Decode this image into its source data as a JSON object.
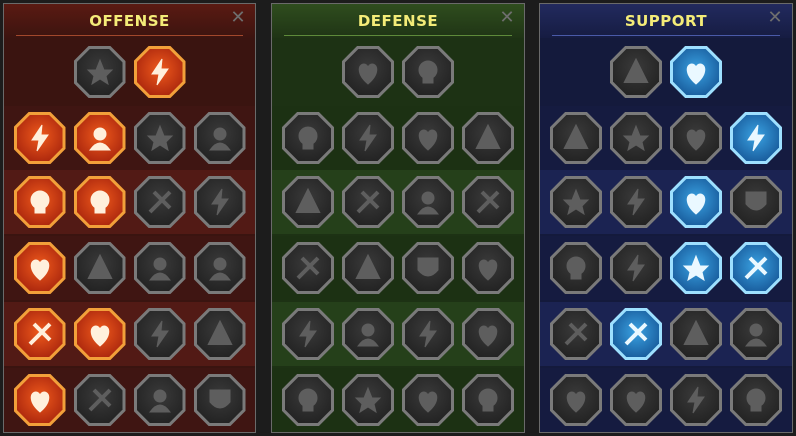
{
  "panels": {
    "offense": {
      "title": "OFFENSE",
      "close_glyph": "✕"
    },
    "defense": {
      "title": "DEFENSE",
      "close_glyph": "✕"
    },
    "support": {
      "title": "SUPPORT",
      "close_glyph": "✕"
    }
  },
  "colors": {
    "title_text": "#f4ec78",
    "offense_bg": "#3a1410",
    "defense_bg": "#1d3214",
    "support_bg": "#141a3c",
    "active_offense": "#ef5a1c",
    "active_support": "#3aa2e2",
    "inactive": "#5e5e5e"
  },
  "skill_state": {
    "offense": [
      [
        "inactive",
        "active"
      ],
      [
        "active",
        "active",
        "inactive",
        "inactive"
      ],
      [
        "active",
        "active",
        "inactive",
        "inactive"
      ],
      [
        "active",
        "inactive",
        "inactive",
        "inactive"
      ],
      [
        "active",
        "active",
        "inactive",
        "inactive"
      ],
      [
        "active",
        "inactive",
        "inactive",
        "inactive"
      ]
    ],
    "defense": [
      [
        "inactive",
        "inactive"
      ],
      [
        "inactive",
        "inactive",
        "inactive",
        "inactive"
      ],
      [
        "inactive",
        "inactive",
        "inactive",
        "inactive"
      ],
      [
        "inactive",
        "inactive",
        "inactive",
        "inactive"
      ],
      [
        "inactive",
        "inactive",
        "inactive",
        "inactive"
      ],
      [
        "inactive",
        "inactive",
        "inactive",
        "inactive"
      ]
    ],
    "support": [
      [
        "inactive",
        "active"
      ],
      [
        "inactive",
        "inactive",
        "inactive",
        "active"
      ],
      [
        "inactive",
        "inactive",
        "active",
        "inactive"
      ],
      [
        "inactive",
        "inactive",
        "active",
        "active"
      ],
      [
        "inactive",
        "active",
        "inactive",
        "inactive"
      ],
      [
        "inactive",
        "inactive",
        "inactive",
        "inactive"
      ]
    ]
  },
  "icons": {
    "offense": [
      [
        "crossed-swords-icon",
        "flaming-sword-icon"
      ],
      [
        "horned-demon-icon",
        "triple-slash-icon",
        "shield-pierce-icon",
        "broken-heart-icon"
      ],
      [
        "daggers-icon",
        "fanged-maw-icon",
        "skull-icon",
        "scythe-icon"
      ],
      [
        "flaming-blade-icon",
        "fist-hammer-icon",
        "axe-icon",
        "chain-lightning-icon"
      ],
      [
        "lightning-strike-icon",
        "twin-skulls-icon",
        "blade-icon",
        "berserker-icon"
      ],
      [
        "sparkling-sword-icon",
        "knight-helmet-icon",
        "demon-figure-icon",
        "skull-warrior-icon"
      ]
    ],
    "defense": [
      [
        "armor-plates-icon",
        "raised-fist-icon"
      ],
      [
        "shoulder-plate-icon",
        "heart-armor-icon",
        "strongman-icon",
        "deflect-icon"
      ],
      [
        "rope-figure-icon",
        "shield-bearer-icon",
        "skull-heart-icon",
        "halo-figure-icon"
      ],
      [
        "crowd-icon",
        "hourglass-sun-icon",
        "open-hand-icon",
        "bull-icon"
      ],
      [
        "running-wall-icon",
        "triple-drop-icon",
        "flaming-skull-icon",
        "shield-swirl-icon"
      ],
      [
        "guardian-icon",
        "winged-shield-icon",
        "bearded-face-icon",
        "flexing-icon"
      ]
    ],
    "support": [
      [
        "heart-sparkle-icon",
        "spiral-hand-icon"
      ],
      [
        "praying-hands-icon",
        "barrier-arc-icon",
        "flame-skull-icon",
        "speed-dash-icon"
      ],
      [
        "glowing-figure-icon",
        "lightning-bolt-icon",
        "crackle-icon",
        "twin-figures-icon"
      ],
      [
        "chained-heart-icon",
        "comet-icon",
        "open-book-icon",
        "fierce-eyes-icon"
      ],
      [
        "compass-star-icon",
        "winged-boot-icon",
        "all-seeing-eye-icon",
        "acrobat-icon"
      ],
      [
        "potion-skull-icon",
        "hooded-skull-icon",
        "grabbing-hand-icon",
        "eagle-head-icon"
      ]
    ]
  }
}
